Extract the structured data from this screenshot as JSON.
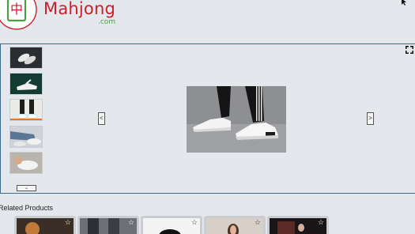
{
  "brand": {
    "name": "Mahjong",
    "tld": ".com",
    "mark_glyph": "中",
    "primary_color": "#c8202c",
    "accent_color": "#4aa046"
  },
  "gallery": {
    "thumbnails": [
      {
        "name": "sneakers-top-view"
      },
      {
        "name": "sneaker-green-bg"
      },
      {
        "name": "sneakers-on-feet"
      },
      {
        "name": "sneakers-jeans"
      },
      {
        "name": "sneaker-hand"
      }
    ],
    "thumbs_down_label": "⌄",
    "prev_label": "<",
    "next_label": ">",
    "fullscreen_icon": "expand-icon"
  },
  "related": {
    "title": "Related Products",
    "star_glyph": "☆",
    "items": [
      {
        "name": "related-1"
      },
      {
        "name": "related-2"
      },
      {
        "name": "related-3"
      },
      {
        "name": "related-4"
      },
      {
        "name": "related-5"
      }
    ]
  }
}
